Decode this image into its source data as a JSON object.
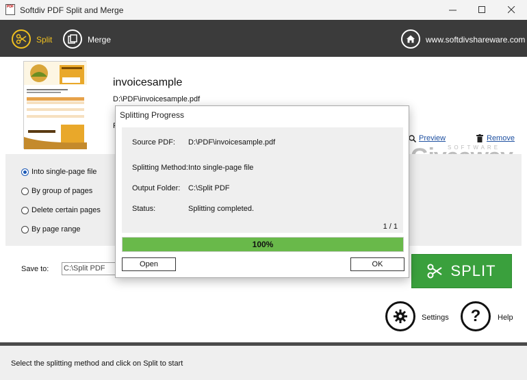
{
  "window": {
    "title": "Softdiv PDF Split and Merge",
    "logo_text": "PDF"
  },
  "toolbar": {
    "split_label": "Split",
    "merge_label": "Merge",
    "website": "www.softdivshareware.com"
  },
  "document": {
    "name": "invoicesample",
    "path": "D:\\PDF\\invoicesample.pdf",
    "truncated_line": "F",
    "preview_label": "Preview",
    "remove_label": "Remove"
  },
  "watermark": {
    "small": "SOFTWARE",
    "big": "Giveaway"
  },
  "options": {
    "items": [
      {
        "label": "Into single-page file",
        "selected": true
      },
      {
        "label": "By group of pages",
        "selected": false
      },
      {
        "label": "Delete certain pages",
        "selected": false
      },
      {
        "label": "By page range",
        "selected": false
      }
    ]
  },
  "save": {
    "label": "Save to:",
    "value": "C:\\Split PDF"
  },
  "actions": {
    "split_label": "SPLIT",
    "settings_label": "Settings",
    "help_label": "Help"
  },
  "status": {
    "text": "Select the splitting method and click on Split to start"
  },
  "dialog": {
    "title": "Splitting Progress",
    "rows": [
      {
        "label": "Source PDF:",
        "value": "D:\\PDF\\invoicesample.pdf"
      },
      {
        "label": "Splitting Method:",
        "value": "Into single-page file"
      },
      {
        "label": "Output Folder:",
        "value": "C:\\Split PDF"
      },
      {
        "label": "Status:",
        "value": "Splitting completed."
      }
    ],
    "page_count": "1 / 1",
    "progress_fraction": 1.0,
    "progress_text": "100%",
    "open_label": "Open",
    "ok_label": "OK"
  },
  "colors": {
    "toolbar_bg": "#3b3b3b",
    "accent_yellow": "#f0c020",
    "split_green": "#3aa03d",
    "progress_green": "#69b94a",
    "link_blue": "#1d4fa0"
  }
}
